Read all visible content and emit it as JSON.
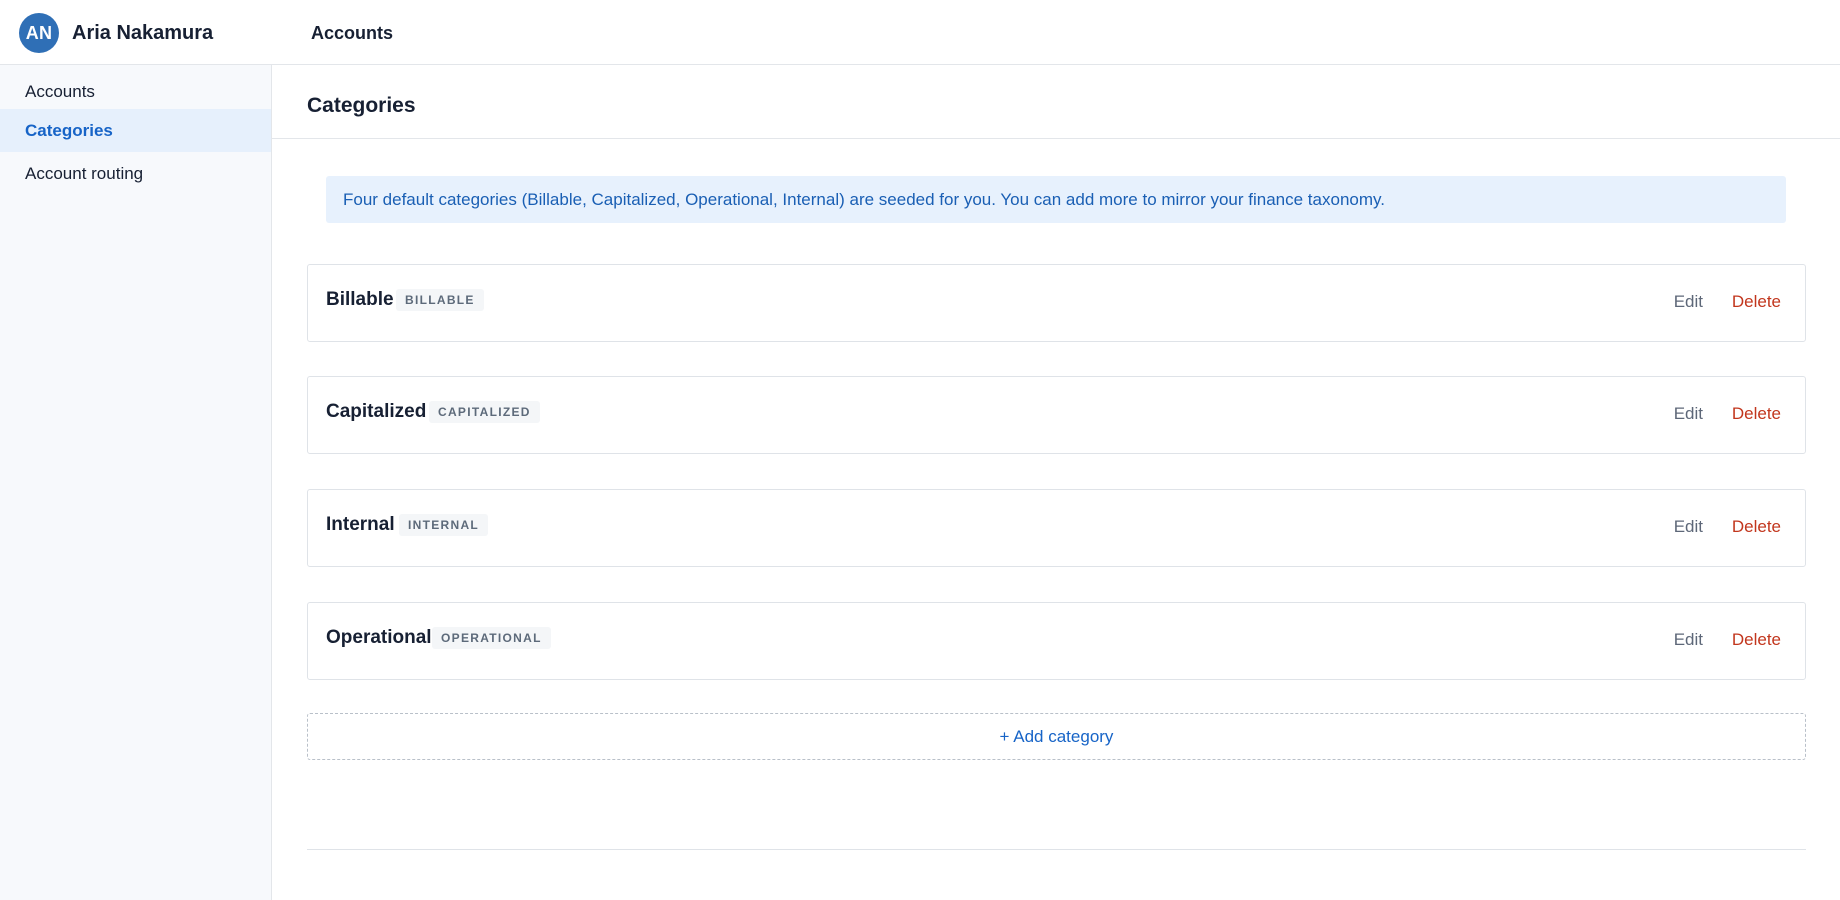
{
  "header": {
    "avatar_initials": "AN",
    "user_name": "Aria Nakamura",
    "section_title": "Accounts"
  },
  "sidebar": {
    "items": [
      {
        "label": "Accounts",
        "active": false
      },
      {
        "label": "Categories",
        "active": true
      },
      {
        "label": "Account routing",
        "active": false
      }
    ]
  },
  "main": {
    "page_title": "Categories",
    "notice": "Four default categories (Billable, Capitalized, Operational, Internal) are seeded for you. You can add more to mirror your finance taxonomy.",
    "categories": [
      {
        "name": "Billable",
        "badge": "BILLABLE"
      },
      {
        "name": "Capitalized",
        "badge": "CAPITALIZED"
      },
      {
        "name": "Internal",
        "badge": "INTERNAL"
      },
      {
        "name": "Operational",
        "badge": "OPERATIONAL"
      }
    ],
    "edit_label": "Edit",
    "delete_label": "Delete",
    "add_label": "+ Add category"
  },
  "colors": {
    "accent": "#1764c7",
    "danger": "#c2361d",
    "avatar": "#2f6fb6"
  }
}
